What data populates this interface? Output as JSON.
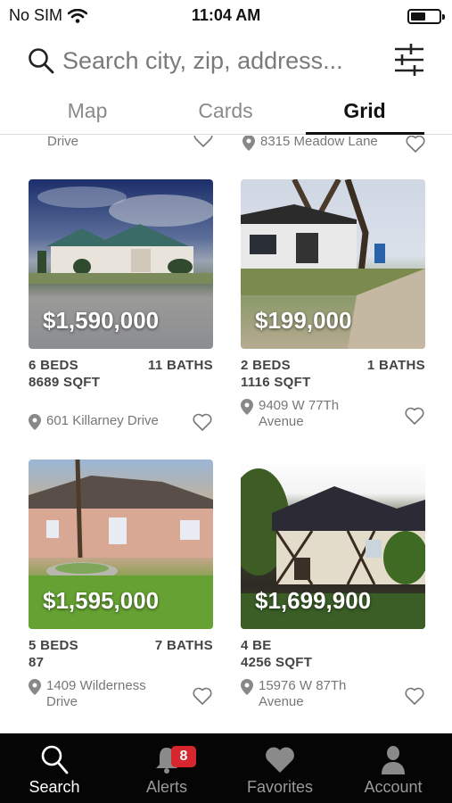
{
  "status": {
    "carrier": "No SIM",
    "time": "11:04 AM"
  },
  "search": {
    "placeholder": "Search city, zip, address..."
  },
  "tabs": [
    {
      "label": "Map"
    },
    {
      "label": "Cards"
    },
    {
      "label": "Grid",
      "active": true
    }
  ],
  "partial_row": [
    {
      "address": "Drive"
    },
    {
      "address": "8315 Meadow Lane"
    }
  ],
  "listings": [
    {
      "price": "$1,590,000",
      "beds": "6 BEDS",
      "baths": "11 BATHS",
      "sqft": "8689 SQFT",
      "address": "601 Killarney Drive"
    },
    {
      "price": "$199,000",
      "beds": "2 BEDS",
      "baths": "1 BATHS",
      "sqft": "1116 SQFT",
      "address": "9409 W 77Th Avenue"
    },
    {
      "price": "$1,595,000",
      "beds": "5 BEDS",
      "baths": "7 BATHS",
      "sqft": "87",
      "address": "1409 Wilderness Drive"
    },
    {
      "price": "$1,699,900",
      "beds": "4 BE",
      "baths": "",
      "sqft": "4256 SQFT",
      "address": "15976 W 87Th Avenue"
    }
  ],
  "tabbar": {
    "items": [
      {
        "label": "Search",
        "icon": "search-icon",
        "active": true
      },
      {
        "label": "Alerts",
        "icon": "bell-icon",
        "badge": "8"
      },
      {
        "label": "Favorites",
        "icon": "heart-icon"
      },
      {
        "label": "Account",
        "icon": "person-icon"
      }
    ]
  },
  "colors": {
    "accent": "#111111",
    "badge": "#d7262e",
    "tabbar_bg": "#050505",
    "muted": "#8a8a8a"
  }
}
